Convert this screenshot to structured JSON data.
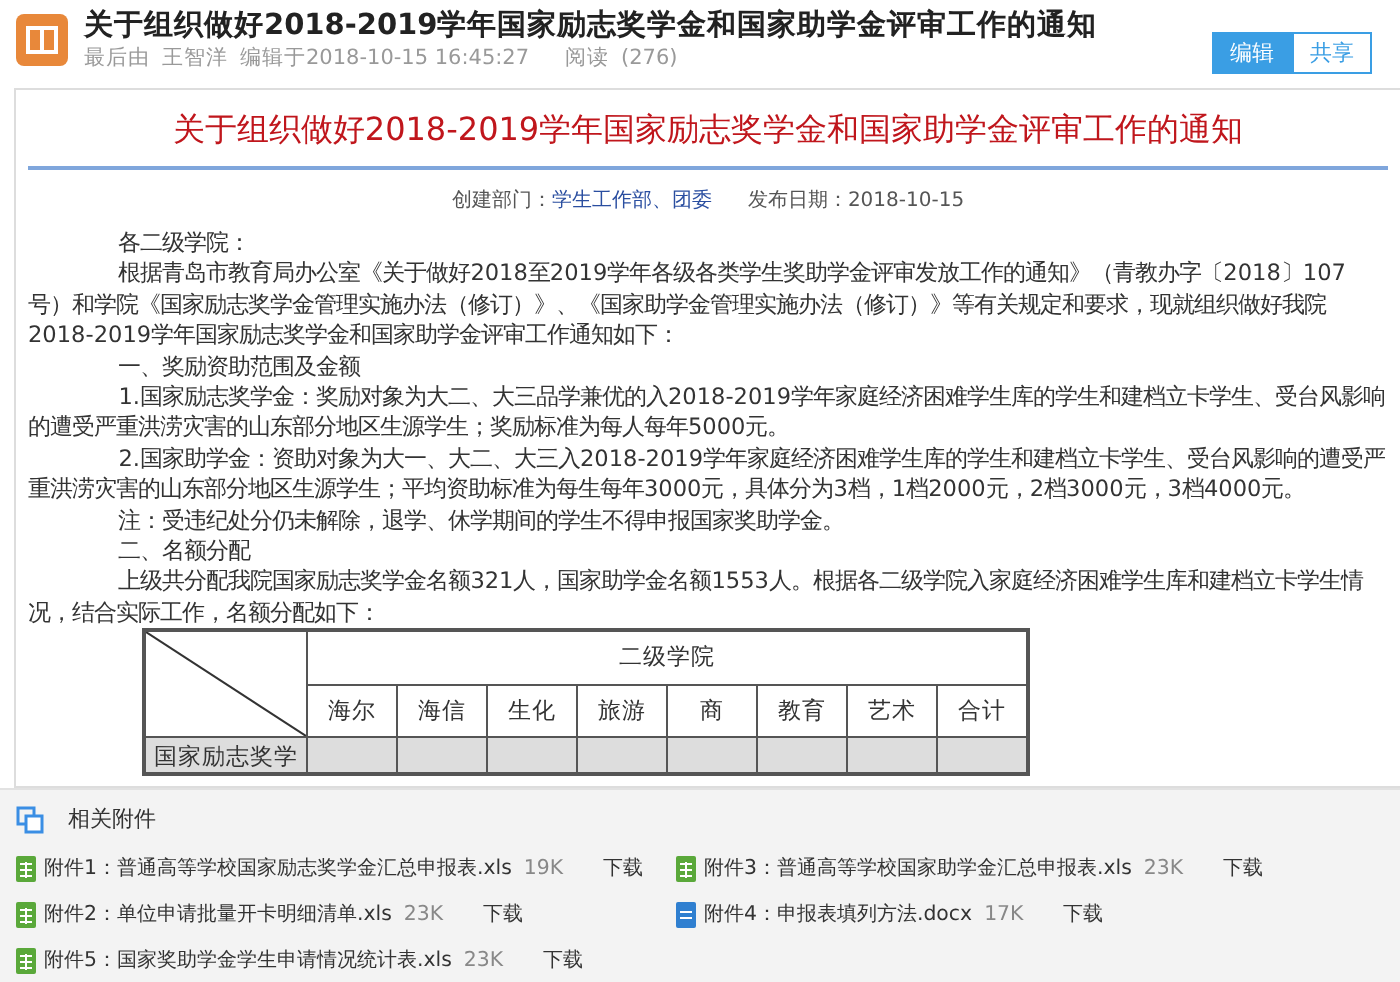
{
  "header": {
    "title": "关于组织做好2018-2019学年国家励志奖学金和国家助学金评审工作的通知",
    "meta": {
      "prefix": "最后由",
      "author": "王智洋",
      "edited": "编辑于2018-10-15 16:45:27",
      "reads_label": "阅读",
      "reads": "(276)"
    },
    "buttons": [
      {
        "label": "编辑",
        "selected": true
      },
      {
        "label": "共享",
        "selected": false
      }
    ]
  },
  "document": {
    "title": "关于组织做好2018-2019学年国家励志奖学金和国家助学金评审工作的通知",
    "info": {
      "dept_label": "创建部门：",
      "dept": "学生工作部、团委",
      "date_label": "发布日期：",
      "date": "2018-10-15"
    },
    "paragraphs": [
      "各二级学院：",
      "根据青岛市教育局办公室《关于做好2018至2019学年各级各类学生奖助学金评审发放工作的通知》（青教办字〔2018〕107号）和学院《国家励志奖学金管理实施办法（修订）》、《国家助学金管理实施办法（修订）》等有关规定和要求，现就组织做好我院2018-2019学年国家励志奖学金和国家助学金评审工作通知如下：",
      "一、奖励资助范围及金额",
      "1.国家励志奖学金：奖励对象为大二、大三品学兼优的入2018-2019学年家庭经济困难学生库的学生和建档立卡学生、受台风影响的遭受严重洪涝灾害的山东部分地区生源学生；奖励标准为每人每年5000元。",
      "2.国家助学金：资助对象为大一、大二、大三入2018-2019学年家庭经济困难学生库的学生和建档立卡学生、受台风影响的遭受严重洪涝灾害的山东部分地区生源学生；平均资助标准为每生每年3000元，具体分为3档，1档2000元，2档3000元，3档4000元。",
      "注：受违纪处分仍未解除，退学、休学期间的学生不得申报国家奖助学金。",
      "二、名额分配",
      "上级共分配我院国家励志奖学金名额321人，国家助学金名额1553人。根据各二级学院入家庭经济困难学生库和建档立卡学生情况，结合实际工作，名额分配如下："
    ],
    "table": {
      "group_header": "二级学院",
      "columns": [
        "海尔",
        "海信",
        "生化",
        "旅游",
        "商",
        "教育",
        "艺术",
        "合计"
      ],
      "rows": [
        {
          "label": "国家励志奖学"
        }
      ]
    }
  },
  "attachments": {
    "title": "相关附件",
    "items": [
      {
        "kind": "xls",
        "name": "附件1：普通高等学校国家励志奖学金汇总申报表.xls",
        "size": "19K",
        "action": "下载"
      },
      {
        "kind": "xls",
        "name": "附件3：普通高等学校国家助学金汇总申报表.xls",
        "size": "23K",
        "action": "下载"
      },
      {
        "kind": "xls",
        "name": "附件2：单位申请批量开卡明细清单.xls",
        "size": "23K",
        "action": "下载"
      },
      {
        "kind": "doc",
        "name": "附件4：申报表填列方法.docx",
        "size": "17K",
        "action": "下载"
      },
      {
        "kind": "xls",
        "name": "附件5：国家奖助学金学生申请情况统计表.xls",
        "size": "23K",
        "action": "下载"
      }
    ]
  }
}
